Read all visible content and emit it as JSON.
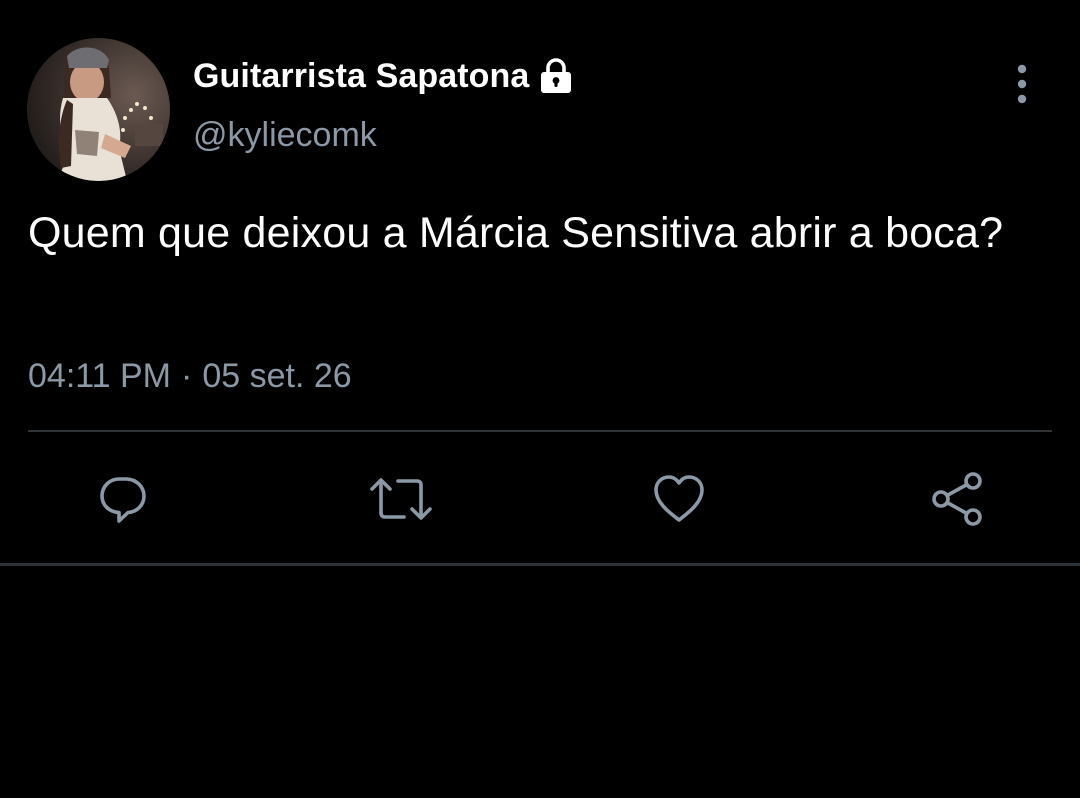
{
  "tweet": {
    "author": {
      "display_name": "Guitarrista Sapatona",
      "handle": "@kyliecomk",
      "protected_icon": "lock-icon"
    },
    "text": "Quem que deixou a Márcia Sensitiva abrir a boca?",
    "time": "04:11 PM",
    "separator": "·",
    "date": "05 set. 26",
    "more_icon": "more-vertical-icon"
  },
  "actions": [
    {
      "name": "reply",
      "icon": "reply-icon"
    },
    {
      "name": "retweet",
      "icon": "retweet-icon"
    },
    {
      "name": "like",
      "icon": "heart-icon"
    },
    {
      "name": "share",
      "icon": "share-icon"
    }
  ],
  "colors": {
    "background": "#000000",
    "primary_text": "#ffffff",
    "secondary_text": "#8b98a5",
    "divider": "#2f3336",
    "icon": "#8b98a5"
  }
}
